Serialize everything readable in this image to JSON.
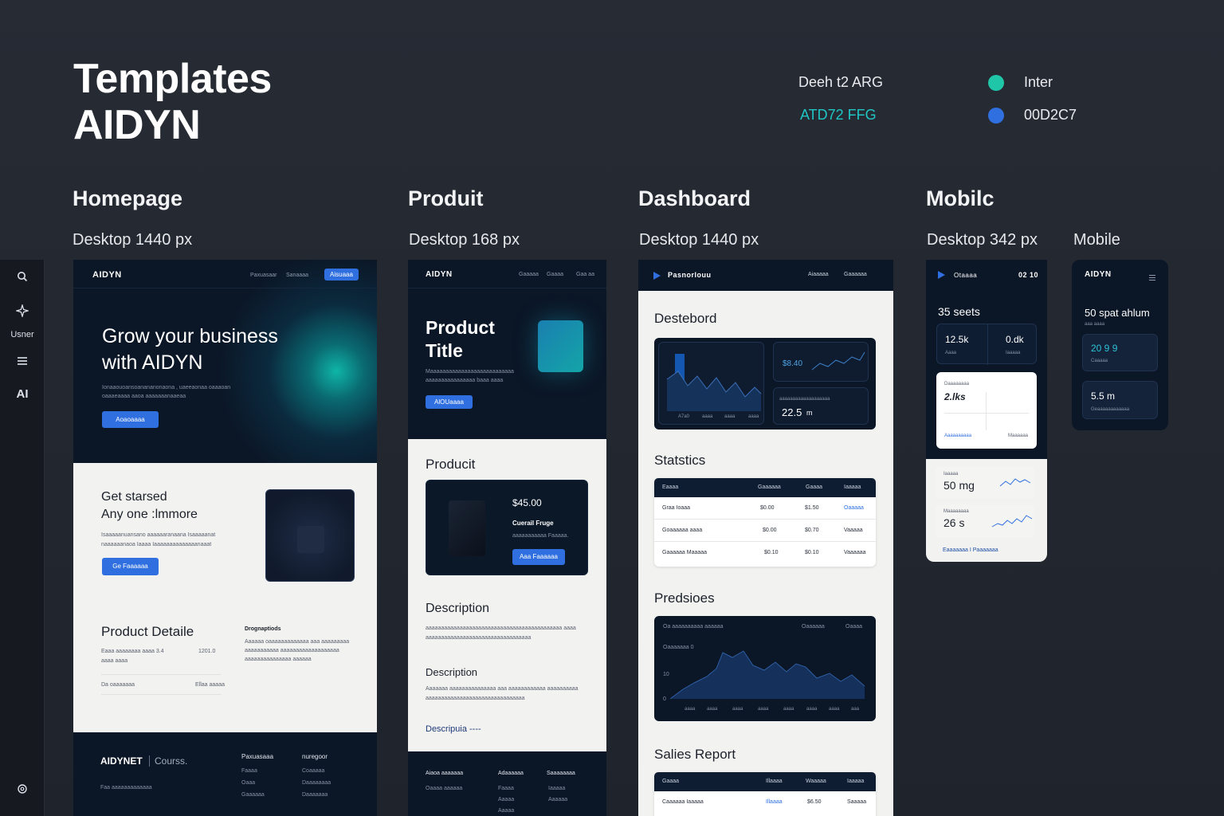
{
  "header": {
    "title_line1": "Templates",
    "title_line2": "AIDYN",
    "font_label": "Deeh t2 ARG",
    "font_code": "ATD72 FFG",
    "swatch1_label": "Inter",
    "swatch2_label": "00D2C7"
  },
  "colors": {
    "teal": "#1fc6a8",
    "blue": "#2f6fe0",
    "accent_text": "#1fc6c4"
  },
  "sections": [
    {
      "title": "Homepage",
      "subtitle": "Desktop 1440 px"
    },
    {
      "title": "Produit",
      "subtitle": "Desktop 168 px"
    },
    {
      "title": "Dashboard",
      "subtitle": "Desktop 1440 px"
    },
    {
      "title": "Mobilc",
      "subtitle": "Desktop 342 px"
    },
    {
      "title": "",
      "subtitle": "Mobile"
    }
  ],
  "rail": {
    "search_icon": "search-icon",
    "spark_icon": "sparkle-icon",
    "user_label": "Usner",
    "menu_icon": "menu-icon",
    "ai_label": "AI",
    "settings_icon": "gear-icon"
  },
  "homepage": {
    "brand": "AIDYN",
    "nav": [
      "Paxuasaar",
      "Sanaaaa"
    ],
    "nav_button": "Aisuaaa",
    "hero_line1": "Grow your business",
    "hero_line2": "with AIDYN",
    "hero_text1": "Ionaaouoansoanananonaona , uaeeaonaa oaaaoan",
    "hero_text2": "oaaaeaaaa aaoa aaaaaaanaaeaa",
    "hero_button": "Aoaoaaaa",
    "gs_line1": "Get starsed",
    "gs_line2": "Any one :lmmore",
    "gs_text1": "Isaaaaanuansano aaaaaaranaana Isaaaaanat",
    "gs_text2": "naaaaaanaoa Iaaaa Iaaaaaaaaaaaaaanaaat",
    "gs_button": "Ge Faaaaaa",
    "pd_title": "Product Detaile",
    "pd_left1": "Eaaa aaaaaaaa aaaa  3.4",
    "pd_left2": "aaaa aaaa",
    "pd_value": "1201.0",
    "pd_right_title": "Drognaptiods",
    "pd_right1": "Aaaaaa oaaaaaaaaaaaaa aaa aaaaaaaaa",
    "pd_right2": "aaaaaaaaaaa aaaaaaaaaaaaaaaaaaa",
    "pd_right3": "aaaaaaaaaaaaaaa aaaaaa",
    "row_left": "Da oaaaaaaa",
    "row_right": "Ellaa aaaaa",
    "footer_brand": "AIDYNET",
    "footer_sep": "Courss.",
    "footer_text": "Faa aaaaaaaaaaaaa",
    "footer_col1_title": "Paxuasaaa",
    "footer_col1": [
      "Faaaa",
      "Oaaa",
      "Gaaaaaa"
    ],
    "footer_col2_title": "nuregoor",
    "footer_col2": [
      "Coaaaaa",
      "Daaaaaaaa",
      "Daaaaaaa"
    ]
  },
  "produit": {
    "brand": "AIDYN",
    "nav": [
      "Gaaaaa",
      "Gaaaa",
      "Gaa aa"
    ],
    "hero_line1": "Product",
    "hero_line2": "Title",
    "hero_text1": "Maaaaaaaaaaaaaaaaaaaaaaaaaaa",
    "hero_text2": "aaaaaaaaaaaaaaaa baaa aaaa",
    "hero_button": "AlOUaaaa",
    "section_title": "Producit",
    "price": "$45.00",
    "card_title": "Cuerail Fruge",
    "card_text": "aaaaaaaaaaa Faaaaa.",
    "card_button": "Aaa Faaaaaa",
    "desc_title": "Description",
    "desc_text1": "aaaaaaaaaaaaaaaaaaaaaaaaaaaaaaaaaaaaaaaaaaaa aaaa",
    "desc_text2": "aaaaaaaaaaaaaaaaaaaaaaaaaaaaaaaaaa",
    "desc2_title": "Description",
    "desc2_text1": "Aaaaaaa aaaaaaaaaaaaaaa aaa  aaaaaaaaaaaa aaaaaaaaaa",
    "desc2_text2": "aaaaaaaaaaaaaaaaaaaaaaaaaaaaaaaa",
    "link": "Descripuia ----",
    "footer_col1_title": "Aiaoa aaaaaaa",
    "footer_col1": "Oaaaa aaaaaa",
    "footer_col2_title": "Adaaaaaa",
    "footer_col2": [
      "Faaaa",
      "Aaaaa",
      "Aaaaa"
    ],
    "footer_col3_title": "Saaaaaaaa",
    "footer_col3": [
      "Iaaaaa",
      "Aaaaaa"
    ]
  },
  "dashboard": {
    "brand": "Pasnorlouu",
    "nav": [
      "Aiaaaaa",
      "Gaaaaaa"
    ],
    "title": "Destebord",
    "chart_x": [
      "A7a0",
      "aaaa",
      "aaaa",
      "aaaa"
    ],
    "kpi_value": "$8.40",
    "kpi2_label": "aaaaaaaaaaaaaaaaaaa",
    "kpi2_value": "22.5",
    "kpi2_unit": "m",
    "stats_title": "Statstics",
    "stats_cols": [
      "Eaaaa",
      "Gaaaaaa",
      "Gaaaa",
      "Iaaaaa"
    ],
    "stats_rows": [
      [
        "Graa Ioaaa",
        "$0.00",
        "$1.50",
        "Oaaaaa"
      ],
      [
        "Goaaaaaa aaaa",
        "$0.00",
        "$0.70",
        "Vaaaaa"
      ],
      [
        "Gaaaaaa Maaaaa",
        "$0.10",
        "$0.10",
        "Vaaaaaa"
      ]
    ],
    "pred_title": "Predsioes",
    "pred_chart_title": "Oa aaaaaaaaaa aaaaaa",
    "pred_chart_right1": "Oaaaaaa",
    "pred_chart_right2": "Oaaaa",
    "pred_chart_y": [
      "Oaaaaaaa 0",
      "10",
      "0"
    ],
    "pred_chart_x": [
      "aaaa",
      "aaaa",
      "aaaa",
      "aaaa",
      "aaaa",
      "aaaa",
      "aaaa",
      "aaa"
    ],
    "sales_title": "Salies Report",
    "sales_cols": [
      "Gaaaa",
      "Illaaaa",
      "Waaaaa",
      "Iaaaaa"
    ],
    "sales_row": [
      "Caaaaaa Iaaaaa",
      "Illaaaa",
      "$6.50",
      "Saaaaa"
    ]
  },
  "mobile1": {
    "brand": "Otaaaa",
    "time": "02 10",
    "headline": "35 seets",
    "stat1_value": "12.5k",
    "stat1_label": "Aaaa",
    "stat2_value": "0.dk",
    "stat2_label": "Iaaaaa",
    "card_label": "Daaaaaaaa",
    "card_value": "2.lks",
    "card_left": "Aaaaaaaaaa",
    "card_right": "Maaaaaa",
    "m1_label": "Iaaaaa",
    "m1_value": "50 mg",
    "m2_label": "Maaaaaaaa",
    "m2_value": "26 s",
    "link": "Eaaaaaaa I Paaaaaaa"
  },
  "mobile2": {
    "brand": "AIDYN",
    "headline": "50 spat ahlum",
    "sub": "aaa aaaa",
    "card1_value": "20 9 9",
    "card1_label": "Caaaaa",
    "card2_value": "5.5 m",
    "card2_label": "Geaaaaaaaaaaaa"
  }
}
